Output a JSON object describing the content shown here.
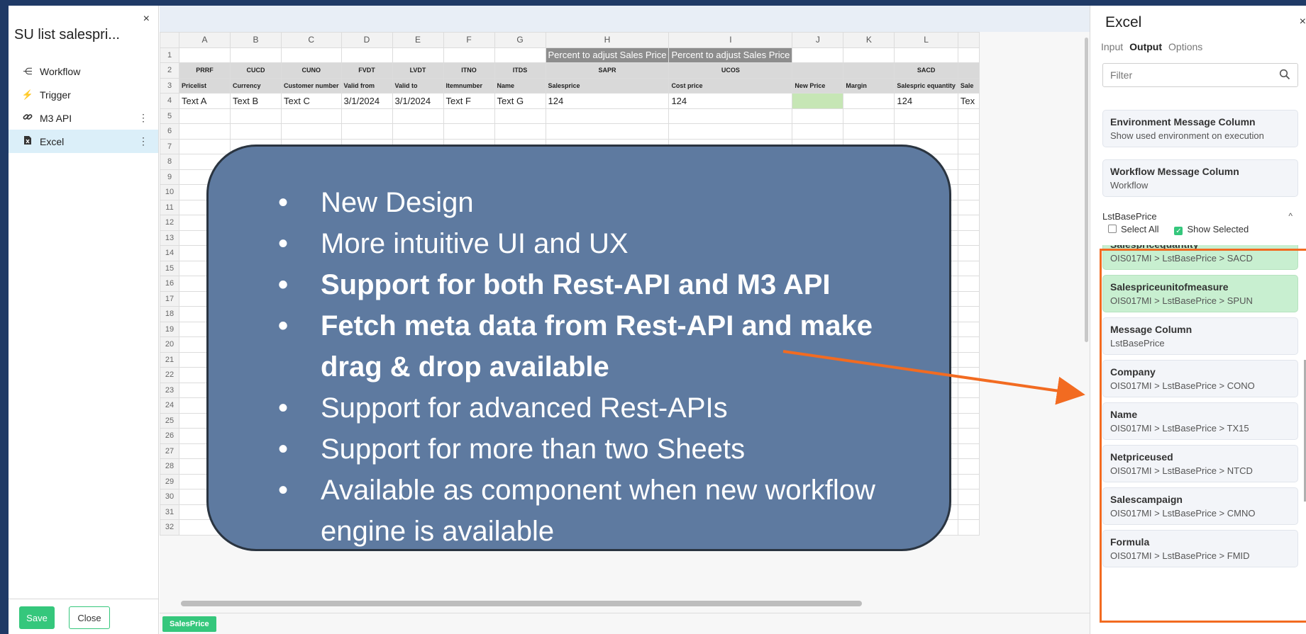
{
  "sidebar": {
    "close": "×",
    "title": "SU list salespri...",
    "items": [
      {
        "label": "Workflow",
        "icon": "workflow-icon",
        "glyph": "⋲"
      },
      {
        "label": "Trigger",
        "icon": "lightning-icon",
        "glyph": "⚡"
      },
      {
        "label": "M3 API",
        "icon": "link-icon",
        "glyph": "🔗",
        "menu": "⋮"
      },
      {
        "label": "Excel",
        "icon": "excel-file-icon",
        "glyph": "▪",
        "menu": "⋮"
      }
    ],
    "save_label": "Save",
    "close_label": "Close"
  },
  "sheet": {
    "columns": [
      "A",
      "B",
      "C",
      "D",
      "E",
      "F",
      "G",
      "H",
      "I",
      "J",
      "K",
      "L"
    ],
    "row1": {
      "H": "Percent to adjust Sales Price",
      "I": "Percent to adjust Sales Price"
    },
    "row2": {
      "A": "PRRF",
      "B": "CUCD",
      "C": "CUNO",
      "D": "FVDT",
      "E": "LVDT",
      "F": "ITNO",
      "G": "ITDS",
      "H": "SAPR",
      "I": "UCOS",
      "L": "SACD"
    },
    "row3": {
      "A": "Pricelist",
      "B": "Currency",
      "C": "Customer number",
      "D": "Valid from",
      "E": "Valid to",
      "F": "Itemnumber",
      "G": "Name",
      "H": "Salesprice",
      "I": "Cost price",
      "J": "New Price",
      "K": "Margin",
      "L": "Salespric equantity",
      "M": "Sale"
    },
    "row4": {
      "A": "Text A",
      "B": "Text B",
      "C": "Text C",
      "D": "3/1/2024",
      "E": "3/1/2024",
      "F": "Text F",
      "G": "Text G",
      "H": "124",
      "I": "124",
      "L": "124",
      "M": "Tex"
    },
    "row_numbers": [
      "1",
      "2",
      "3",
      "4",
      "5",
      "6",
      "7",
      "8",
      "9",
      "10",
      "11",
      "12",
      "13",
      "14",
      "15",
      "16",
      "17",
      "18",
      "19",
      "20",
      "21",
      "22",
      "23",
      "24",
      "25",
      "26",
      "27",
      "28",
      "29",
      "30",
      "31",
      "32"
    ],
    "tab": "SalesPrice",
    "green_cell": "J4"
  },
  "panel": {
    "title": "Excel",
    "close": "×",
    "tabs": [
      "Input",
      "Output",
      "Options"
    ],
    "active_tab": "Output",
    "filter_placeholder": "Filter",
    "env_card": {
      "title": "Environment Message Column",
      "sub": "Show used environment on execution"
    },
    "wf_card": {
      "title": "Workflow Message Column",
      "sub": "Workflow"
    },
    "group": {
      "name": "LstBasePrice",
      "select_all": "Select All",
      "show_selected": "Show Selected",
      "chevron": "^",
      "check": "✓"
    },
    "fields": [
      {
        "title": "Salespricequantity",
        "sub": "OIS017MI > LstBasePrice > SACD",
        "highlighted": true
      },
      {
        "title": "Salespriceunitofmeasure",
        "sub": "OIS017MI > LstBasePrice > SPUN",
        "highlighted": true
      },
      {
        "title": "Message Column",
        "sub": "LstBasePrice",
        "highlighted": false
      },
      {
        "title": "Company",
        "sub": "OIS017MI > LstBasePrice > CONO",
        "highlighted": false
      },
      {
        "title": "Name",
        "sub": "OIS017MI > LstBasePrice > TX15",
        "highlighted": false
      },
      {
        "title": "Netpriceused",
        "sub": "OIS017MI > LstBasePrice > NTCD",
        "highlighted": false
      },
      {
        "title": "Salescampaign",
        "sub": "OIS017MI > LstBasePrice > CMNO",
        "highlighted": false
      },
      {
        "title": "Formula",
        "sub": "OIS017MI > LstBasePrice > FMID",
        "highlighted": false
      }
    ]
  },
  "overlay": {
    "bullet": "•",
    "bullets": [
      {
        "text": "New Design",
        "bold": false
      },
      {
        "text": "More intuitive UI and UX",
        "bold": false
      },
      {
        "text": "Support for both Rest-API and M3 API",
        "bold": true
      },
      {
        "text": "Fetch meta data from Rest-API and make drag & drop available",
        "bold": true
      },
      {
        "text": "Support for advanced Rest-APIs",
        "bold": false
      },
      {
        "text": "Support for more than two Sheets",
        "bold": false
      },
      {
        "text": "Available as component when new workflow engine is available",
        "bold": false
      }
    ]
  },
  "colors": {
    "accent_green": "#35c77c",
    "callout_blue": "#5e7aa0",
    "highlight_orange": "#f26b21",
    "slide_background": "#1f3a66"
  }
}
